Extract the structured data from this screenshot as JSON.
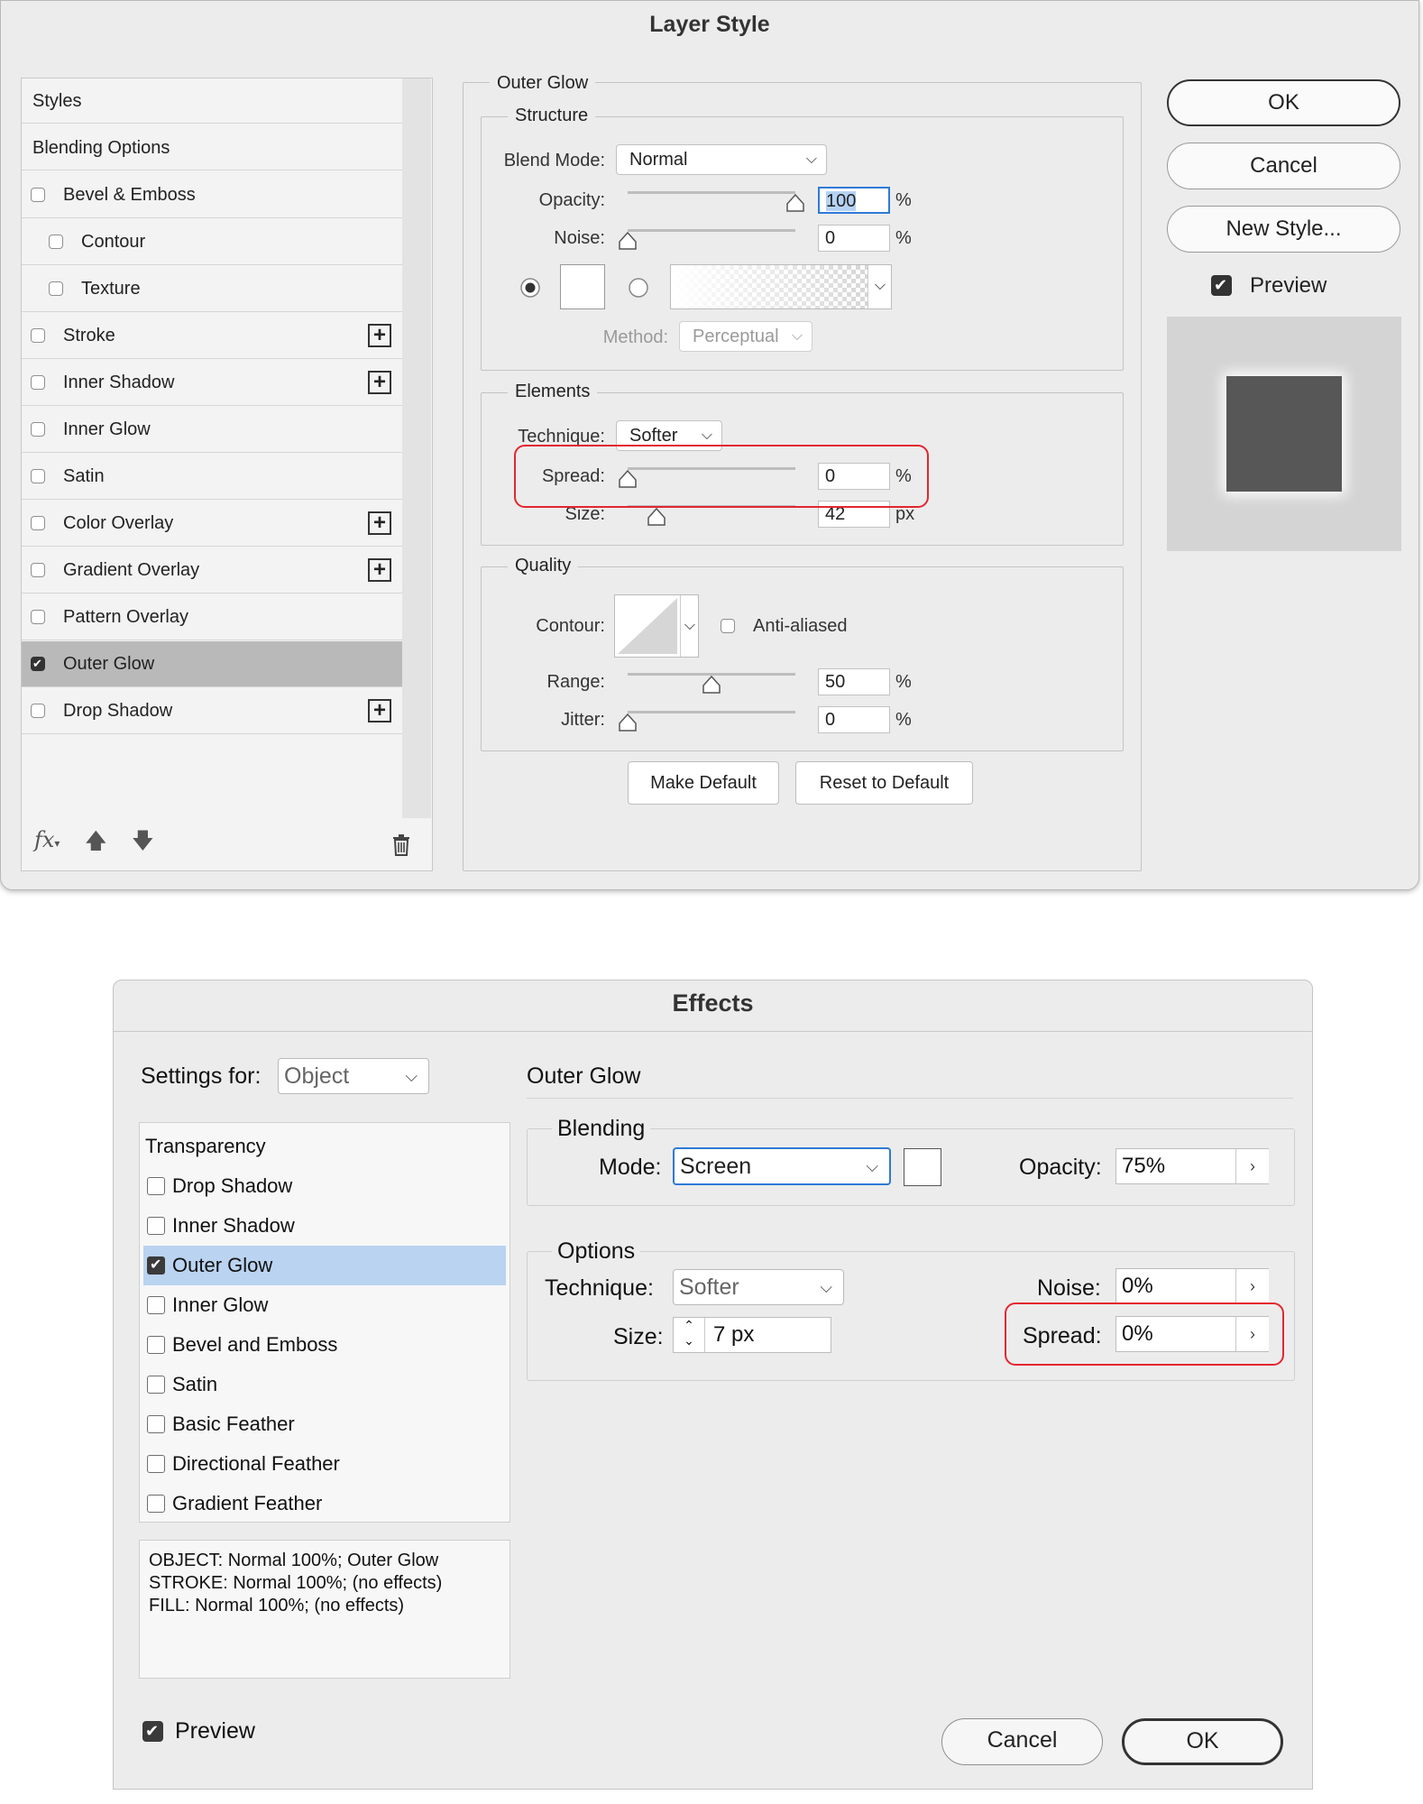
{
  "layer_style": {
    "title": "Layer Style",
    "styles_header": "Styles",
    "blending_options": "Blending Options",
    "items": [
      {
        "label": "Bevel & Emboss",
        "checked": false,
        "indent": false,
        "plus": false
      },
      {
        "label": "Contour",
        "checked": false,
        "indent": true,
        "plus": false
      },
      {
        "label": "Texture",
        "checked": false,
        "indent": true,
        "plus": false
      },
      {
        "label": "Stroke",
        "checked": false,
        "indent": false,
        "plus": true
      },
      {
        "label": "Inner Shadow",
        "checked": false,
        "indent": false,
        "plus": true
      },
      {
        "label": "Inner Glow",
        "checked": false,
        "indent": false,
        "plus": false
      },
      {
        "label": "Satin",
        "checked": false,
        "indent": false,
        "plus": false
      },
      {
        "label": "Color Overlay",
        "checked": false,
        "indent": false,
        "plus": true
      },
      {
        "label": "Gradient Overlay",
        "checked": false,
        "indent": false,
        "plus": true
      },
      {
        "label": "Pattern Overlay",
        "checked": false,
        "indent": false,
        "plus": false
      },
      {
        "label": "Outer Glow",
        "checked": true,
        "indent": false,
        "plus": false,
        "selected": true
      },
      {
        "label": "Drop Shadow",
        "checked": false,
        "indent": false,
        "plus": true
      }
    ],
    "footer": {
      "fx": "fx"
    },
    "outer_glow": {
      "title": "Outer Glow",
      "structure": {
        "title": "Structure",
        "blend_mode_label": "Blend Mode:",
        "blend_mode": "Normal",
        "opacity_label": "Opacity:",
        "opacity": "100",
        "opacity_level": 1.0,
        "noise_label": "Noise:",
        "noise": "0",
        "noise_level": 0.0,
        "unit_percent": "%",
        "method_label": "Method:",
        "method": "Perceptual"
      },
      "elements": {
        "title": "Elements",
        "technique_label": "Technique:",
        "technique": "Softer",
        "spread_label": "Spread:",
        "spread": "0",
        "spread_level": 0.0,
        "size_label": "Size:",
        "size": "42",
        "size_level": 0.17,
        "unit_percent": "%",
        "unit_px": "px"
      },
      "quality": {
        "title": "Quality",
        "contour_label": "Contour:",
        "anti_aliased": "Anti-aliased",
        "range_label": "Range:",
        "range": "50",
        "range_level": 0.5,
        "jitter_label": "Jitter:",
        "jitter": "0",
        "jitter_level": 0.0,
        "unit_percent": "%"
      },
      "make_default": "Make Default",
      "reset_default": "Reset to Default"
    },
    "buttons": {
      "ok": "OK",
      "cancel": "Cancel",
      "new_style": "New Style...",
      "preview": "Preview"
    },
    "colors": {
      "preview_swatch": "#575757",
      "highlight": "#e3262f",
      "selection": "#b9b9b9"
    }
  },
  "effects": {
    "title": "Effects",
    "settings_for_label": "Settings for:",
    "settings_for": "Object",
    "section_title": "Outer Glow",
    "list": [
      {
        "label": "Transparency",
        "header": true
      },
      {
        "label": "Drop Shadow",
        "checked": false
      },
      {
        "label": "Inner Shadow",
        "checked": false
      },
      {
        "label": "Outer Glow",
        "checked": true,
        "selected": true
      },
      {
        "label": "Inner Glow",
        "checked": false
      },
      {
        "label": "Bevel and Emboss",
        "checked": false
      },
      {
        "label": "Satin",
        "checked": false
      },
      {
        "label": "Basic Feather",
        "checked": false
      },
      {
        "label": "Directional Feather",
        "checked": false
      },
      {
        "label": "Gradient Feather",
        "checked": false
      }
    ],
    "summary": [
      "OBJECT: Normal 100%; Outer Glow",
      "STROKE: Normal 100%; (no effects)",
      "FILL: Normal 100%; (no effects)"
    ],
    "blending": {
      "title": "Blending",
      "mode_label": "Mode:",
      "mode": "Screen",
      "opacity_label": "Opacity:",
      "opacity": "75%"
    },
    "options": {
      "title": "Options",
      "technique_label": "Technique:",
      "technique": "Softer",
      "size_label": "Size:",
      "size": "7 px",
      "noise_label": "Noise:",
      "noise": "0%",
      "spread_label": "Spread:",
      "spread": "0%"
    },
    "preview": "Preview",
    "buttons": {
      "cancel": "Cancel",
      "ok": "OK"
    },
    "colors": {
      "selection": "#b9d3f0",
      "highlight": "#e3262f",
      "focus": "#2f7ad6"
    }
  }
}
